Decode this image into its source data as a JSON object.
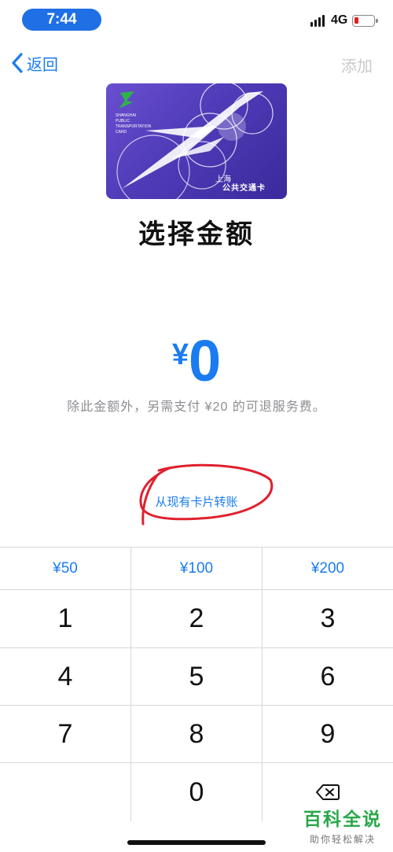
{
  "status_bar": {
    "time": "7:44",
    "network": "4G"
  },
  "nav": {
    "back_label": "返回",
    "add_label": "添加"
  },
  "card": {
    "name_line1": "上海",
    "name_line2": "公共交通卡",
    "logo_text": [
      "SHANGHAI",
      "PUBLIC",
      "TRANSPORTATION",
      "CARD"
    ]
  },
  "page_title": "选择金额",
  "amount": {
    "currency": "¥",
    "value": "0"
  },
  "note": "除此金额外，另需支付 ¥20 的可退服务费。",
  "transfer_link": "从现有卡片转账",
  "keypad": {
    "quick": [
      "¥50",
      "¥100",
      "¥200"
    ],
    "digits": [
      "1",
      "2",
      "3",
      "4",
      "5",
      "6",
      "7",
      "8",
      "9",
      "",
      "0"
    ],
    "delete_icon": "delete-backspace-icon"
  },
  "watermark": {
    "brand": "百科全说",
    "slogan": "助你轻松解决"
  },
  "colors": {
    "accent": "#1a7cf0",
    "time_pill": "#1f6fe5",
    "annotation": "#e0202e"
  }
}
